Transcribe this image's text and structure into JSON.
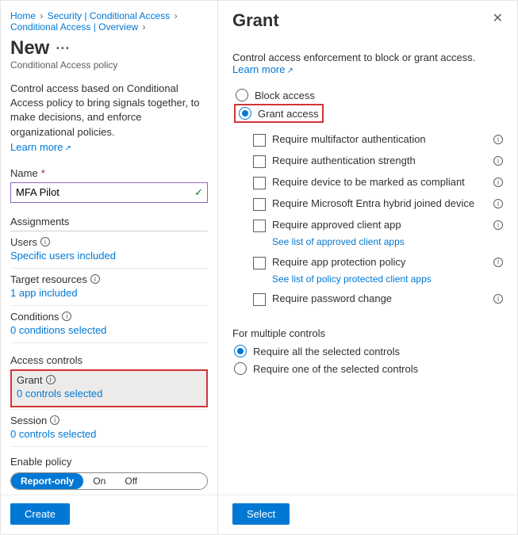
{
  "breadcrumb": {
    "home": "Home",
    "b1": "Security | Conditional Access",
    "b2": "Conditional Access | Overview"
  },
  "left": {
    "title": "New",
    "subtitle": "Conditional Access policy",
    "intro": "Control access based on Conditional Access policy to bring signals together, to make decisions, and enforce organizational policies.",
    "learn_more": "Learn more",
    "name_label": "Name",
    "name_value": "MFA Pilot",
    "section_assignments": "Assignments",
    "users_label": "Users",
    "users_link": "Specific users included",
    "target_label": "Target resources",
    "target_link": "1 app included",
    "conditions_label": "Conditions",
    "conditions_link": "0 conditions selected",
    "section_controls": "Access controls",
    "grant_label": "Grant",
    "grant_link": "0 controls selected",
    "session_label": "Session",
    "session_link": "0 controls selected",
    "enable_label": "Enable policy",
    "toggle": {
      "a": "Report-only",
      "b": "On",
      "c": "Off"
    },
    "create_btn": "Create"
  },
  "right": {
    "title": "Grant",
    "intro": "Control access enforcement to block or grant access.",
    "learn_more": "Learn more",
    "radio_block": "Block access",
    "radio_grant": "Grant access",
    "chk": {
      "mfa": "Require multifactor authentication",
      "strength": "Require authentication strength",
      "compliant": "Require device to be marked as compliant",
      "hybrid": "Require Microsoft Entra hybrid joined device",
      "approved": "Require approved client app",
      "approved_sub": "See list of approved client apps",
      "protection": "Require app protection policy",
      "protection_sub": "See list of policy protected client apps",
      "password": "Require password change"
    },
    "multi_label": "For multiple controls",
    "multi_all": "Require all the selected controls",
    "multi_one": "Require one of the selected controls",
    "select_btn": "Select"
  }
}
